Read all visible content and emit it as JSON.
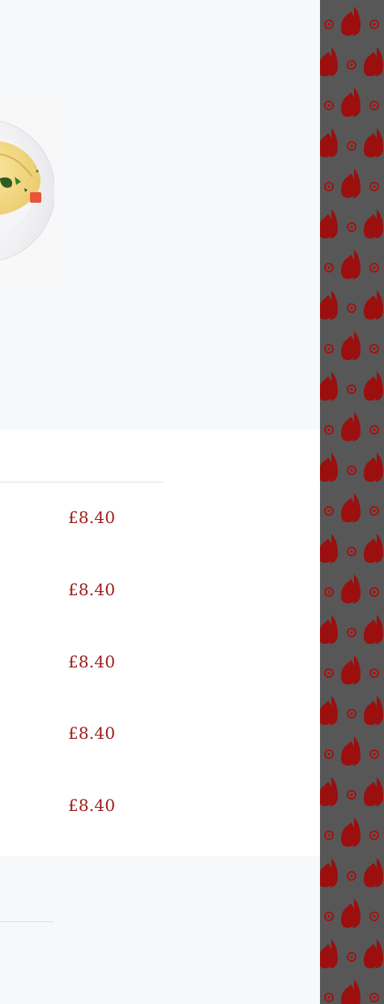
{
  "menu": {
    "items": [
      {
        "price": "£8.40"
      },
      {
        "price": "£8.40"
      },
      {
        "price": "£8.40"
      },
      {
        "price": "£8.40"
      },
      {
        "price": "£8.40"
      }
    ]
  },
  "colors": {
    "accent": "#9b1b1b",
    "pattern_bg": "#575757",
    "pattern_fg": "#9b0f0f",
    "page_bg": "#f7f8fa",
    "card_bg": "#ffffff"
  },
  "icons": {
    "pattern": "red-leaf-pattern-icon",
    "dish": "dish-photo"
  }
}
